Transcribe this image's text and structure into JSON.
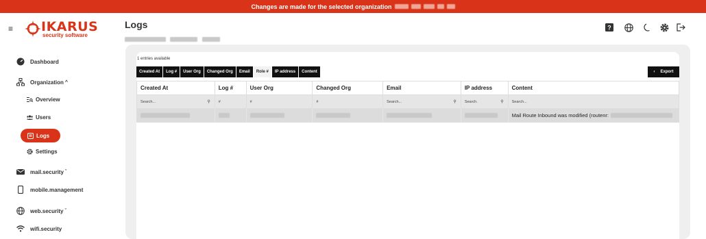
{
  "banner": {
    "text": "Changes are made for the selected organization"
  },
  "header": {
    "title": "Logs"
  },
  "logo": {
    "brand": "IKARUS",
    "tagline": "security software"
  },
  "sidebar": {
    "items": [
      {
        "label": "Dashboard"
      },
      {
        "label": "Organization",
        "caret": "^"
      },
      {
        "label": "Overview"
      },
      {
        "label": "Users"
      },
      {
        "label": "Logs"
      },
      {
        "label": "Settings"
      },
      {
        "label": "mail.security",
        "caret": "ˇ"
      },
      {
        "label": "mobile.management"
      },
      {
        "label": "web.security",
        "caret": "ˇ"
      },
      {
        "label": "wifi.security"
      }
    ]
  },
  "top_icons": [
    "help-icon",
    "globe-icon",
    "moon-icon",
    "gear-icon",
    "logout-icon"
  ],
  "table": {
    "entries_text": "1 entries available",
    "column_toggles": [
      {
        "label": "Created At",
        "active": true
      },
      {
        "label": "Log #",
        "active": true
      },
      {
        "label": "User Org",
        "active": true
      },
      {
        "label": "Changed Org",
        "active": true
      },
      {
        "label": "Email",
        "active": true
      },
      {
        "label": "Role #",
        "active": false
      },
      {
        "label": "IP address",
        "active": true
      },
      {
        "label": "Content",
        "active": true
      }
    ],
    "export_label": "Export",
    "export_icon": "‹",
    "headers": [
      "Created At",
      "Log #",
      "User Org",
      "Changed Org",
      "Email",
      "IP address",
      "Content"
    ],
    "filters": [
      "Search...",
      "#",
      "#",
      "#",
      "Search...",
      "Search.",
      "Search..."
    ],
    "rows": [
      {
        "content": "Mail Route Inbound was modified (routenr:"
      }
    ]
  },
  "colors": {
    "accent": "#d9341a",
    "dark": "#111111"
  }
}
